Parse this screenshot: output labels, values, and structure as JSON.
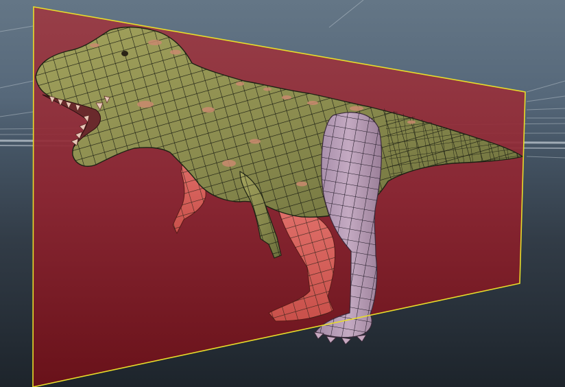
{
  "viewport": {
    "view": "perspective",
    "background_gradient": [
      "#647686",
      "#455565",
      "#1d242b"
    ],
    "grid_color": "#c8d0d8"
  },
  "scene": {
    "model": "t-rex-mesh",
    "display_mode": "wireframe-on-shaded",
    "skin_color": "#8e8f53",
    "wire_color": "#151810",
    "selected_leg_color": "#b9a0b8",
    "backfacing_limbs_color": "#d8625a",
    "skin_patch_color": "#c98a6e"
  },
  "plane": {
    "object": "reference-plane",
    "selected": true,
    "fill_color": "#9a2932",
    "outline_color": "#e8dd2a",
    "opacity": 0.8
  }
}
